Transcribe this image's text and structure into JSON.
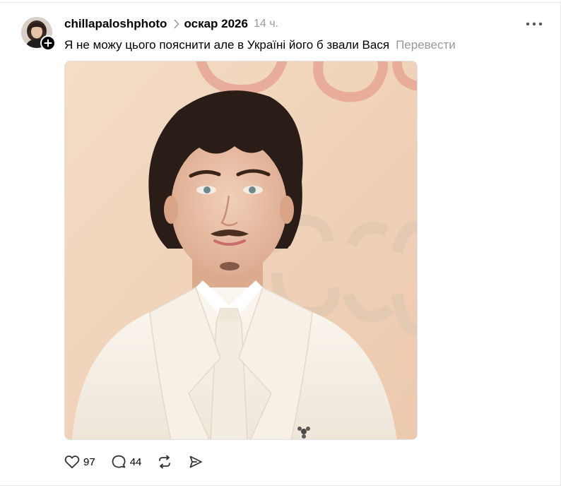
{
  "post": {
    "username": "chillapaloshphoto",
    "topic": "оскар 2026",
    "time": "14 ч.",
    "caption": "Я не можу цього пояснити але в Україні його б звали Вася",
    "translate_label": "Перевести",
    "likes": "97",
    "replies": "44"
  },
  "icons": {
    "more": "more-icon",
    "follow": "plus-icon",
    "separator": "chevron-right-icon",
    "like": "heart-icon",
    "reply": "comment-icon",
    "repost": "repost-icon",
    "share": "send-icon"
  },
  "colors": {
    "text": "#000000",
    "muted": "#999999",
    "border": "#e6e6e6",
    "photo_background": "#f1d6bd",
    "photo_lettering": "#e9a995",
    "suit": "#f7f2ea",
    "hair": "#2a1c16"
  }
}
